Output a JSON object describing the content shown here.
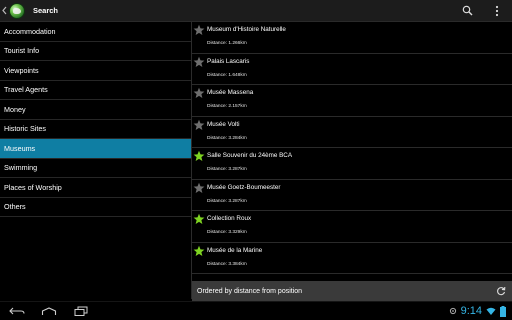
{
  "actionbar": {
    "title": "Search"
  },
  "sidebar": {
    "items": [
      {
        "label": "Accommodation",
        "active": false
      },
      {
        "label": "Tourist Info",
        "active": false
      },
      {
        "label": "Viewpoints",
        "active": false
      },
      {
        "label": "Travel Agents",
        "active": false
      },
      {
        "label": "Money",
        "active": false
      },
      {
        "label": "Historic Sites",
        "active": false
      },
      {
        "label": "Museums",
        "active": true
      },
      {
        "label": "Swimming",
        "active": false
      },
      {
        "label": "Places of Worship",
        "active": false
      },
      {
        "label": "Others",
        "active": false
      }
    ]
  },
  "results": [
    {
      "name": "Museum d'Histoire Naturelle",
      "distance": "Distance: 1.266km",
      "favorite": false
    },
    {
      "name": "Palais Lascaris",
      "distance": "Distance: 1.648km",
      "favorite": false
    },
    {
      "name": "Musée Massena",
      "distance": "Distance: 2.157km",
      "favorite": false
    },
    {
      "name": "Musée Volti",
      "distance": "Distance: 3.284km",
      "favorite": false
    },
    {
      "name": "Salle Souvenir du 24ème BCA",
      "distance": "Distance: 3.287km",
      "favorite": true
    },
    {
      "name": "Musée Goetz-Boumeester",
      "distance": "Distance: 3.287km",
      "favorite": false
    },
    {
      "name": "Collection Roux",
      "distance": "Distance: 3.329km",
      "favorite": true
    },
    {
      "name": "Musée de la Marine",
      "distance": "Distance: 3.384km",
      "favorite": true
    }
  ],
  "sortbar": {
    "label": "Ordered by distance from position"
  },
  "status": {
    "time": "9:14"
  },
  "colors": {
    "accent": "#0f7ea3",
    "favorite_star": "#7ed321",
    "plain_star": "#6e6e6e",
    "clock": "#35b5e5"
  }
}
